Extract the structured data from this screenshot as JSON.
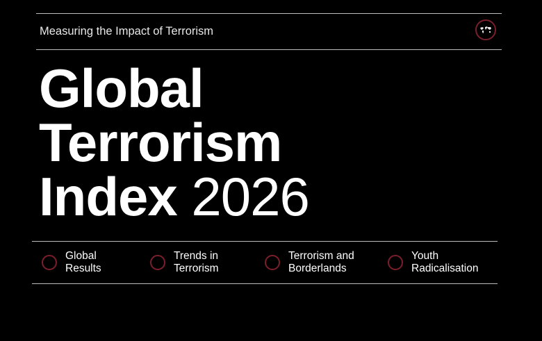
{
  "header": {
    "subtitle": "Measuring the Impact of Terrorism"
  },
  "title": {
    "line1": "Global",
    "line2": "Terrorism",
    "line3_bold": "Index",
    "line3_light": "2026"
  },
  "sections": [
    {
      "line1": "Global",
      "line2": "Results"
    },
    {
      "line1": "Trends in",
      "line2": "Terrorism"
    },
    {
      "line1": "Terrorism and",
      "line2": "Borderlands"
    },
    {
      "line1": "Youth",
      "line2": "Radicalisation"
    }
  ],
  "colors": {
    "background": "#000000",
    "text": "#ffffff",
    "accent_ring": "#7a1f2b",
    "rule": "#bfbfbf"
  },
  "icons": {
    "logo": "world-map-logo-icon",
    "section_marker": "circle-ring-icon"
  }
}
